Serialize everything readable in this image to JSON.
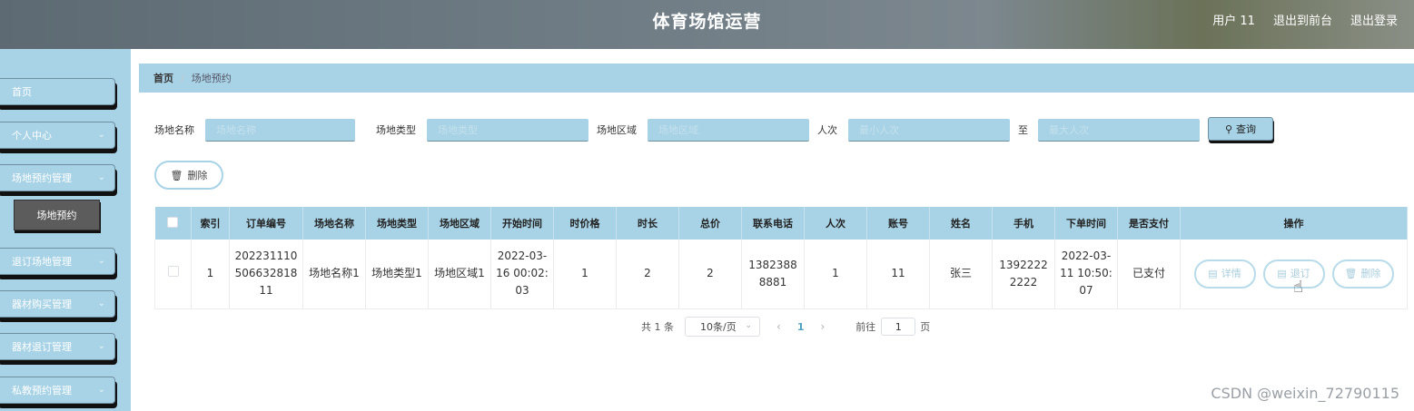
{
  "header": {
    "title": "体育场馆运营",
    "user": "用户 11",
    "back_front": "退出到前台",
    "logout": "退出登录"
  },
  "sidebar": {
    "items": [
      {
        "label": "首页",
        "has_chevron": false
      },
      {
        "label": "个人中心",
        "has_chevron": true
      },
      {
        "label": "场地预约管理",
        "has_chevron": true
      },
      {
        "label": "退订场地管理",
        "has_chevron": true
      },
      {
        "label": "器材购买管理",
        "has_chevron": true
      },
      {
        "label": "器材退订管理",
        "has_chevron": true
      },
      {
        "label": "私教预约管理",
        "has_chevron": true
      }
    ],
    "active_sub": "场地预约"
  },
  "breadcrumb": {
    "home": "首页",
    "current": "场地预约"
  },
  "search": {
    "field1_label": "场地名称",
    "field1_placeholder": "场地名称",
    "field2_label": "场地类型",
    "field2_placeholder": "场地类型",
    "field3_label": "场地区域",
    "field3_placeholder": "场地区域",
    "field4_label": "人次",
    "field4_placeholder": "最小人次",
    "to_label": "至",
    "field5_placeholder": "最大人次",
    "query_label": "查询"
  },
  "toolbar": {
    "delete_label": "删除"
  },
  "table": {
    "headers": [
      "索引",
      "订单编号",
      "场地名称",
      "场地类型",
      "场地区域",
      "开始时间",
      "时价格",
      "时长",
      "总价",
      "联系电话",
      "人次",
      "账号",
      "姓名",
      "手机",
      "下单时间",
      "是否支付",
      "操作"
    ],
    "rows": [
      [
        "1",
        "20223111050663281811",
        "场地名称1",
        "场地类型1",
        "场地区域1",
        "2022-03-16 00:02:03",
        "1",
        "2",
        "2",
        "13823888881",
        "1",
        "11",
        "张三",
        "13922222222",
        "2022-03-11 10:50:07",
        "已支付"
      ]
    ],
    "actions": {
      "detail": "详情",
      "cancel": "退订",
      "delete": "删除"
    }
  },
  "pagination": {
    "total": "共 1 条",
    "page_size": "10条/页",
    "current": "1",
    "goto": "前往",
    "goto_value": "1",
    "page_suffix": "页"
  },
  "watermark": "CSDN @weixin_72790115",
  "colors": {
    "accent": "#a8d3e6",
    "header": "#6e7b84"
  }
}
